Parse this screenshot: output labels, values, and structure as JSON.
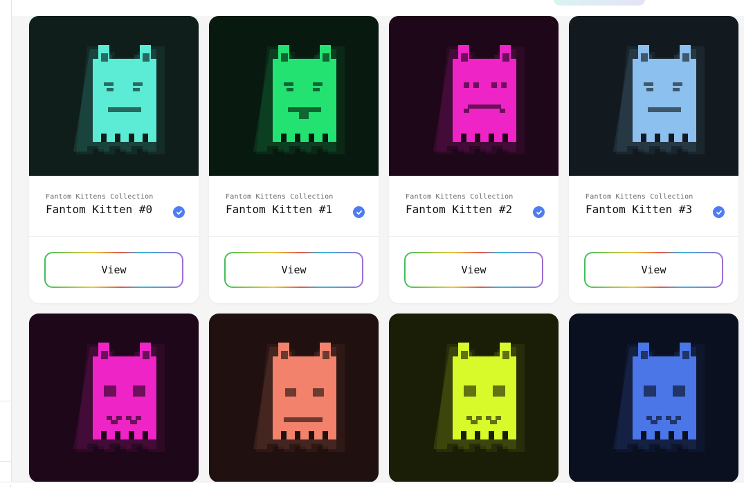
{
  "header": {
    "pill_label": ""
  },
  "cards": [
    {
      "collection": "Fantom Kittens Collection",
      "name": "Fantom Kitten #0",
      "button": "View",
      "bg": "#0f1e1b",
      "body": "#5cecd6",
      "face": "squint-smile",
      "verified": true
    },
    {
      "collection": "Fantom Kittens Collection",
      "name": "Fantom Kitten #1",
      "button": "View",
      "bg": "#081a10",
      "body": "#24e272",
      "face": "tongue",
      "verified": true
    },
    {
      "collection": "Fantom Kittens Collection",
      "name": "Fantom Kitten #2",
      "button": "View",
      "bg": "#1e0718",
      "body": "#ee24c6",
      "face": "frown",
      "verified": true
    },
    {
      "collection": "Fantom Kittens Collection",
      "name": "Fantom Kitten #3",
      "button": "View",
      "bg": "#121a20",
      "body": "#8cc0ee",
      "face": "squint-smile",
      "verified": true
    },
    {
      "collection": "",
      "name": "",
      "button": "",
      "bg": "#1e0718",
      "body": "#ee24c6",
      "face": "cat-mouth"
    },
    {
      "collection": "",
      "name": "",
      "button": "",
      "bg": "#201110",
      "body": "#f2826c",
      "face": "flat"
    },
    {
      "collection": "",
      "name": "",
      "button": "",
      "bg": "#1a1e07",
      "body": "#d8fa2a",
      "face": "cat-mouth-angry"
    },
    {
      "collection": "",
      "name": "",
      "button": "",
      "bg": "#0a1020",
      "body": "#4a76e8",
      "face": "cat-mouth"
    }
  ],
  "icons": {
    "verified": "check-badge-icon"
  }
}
